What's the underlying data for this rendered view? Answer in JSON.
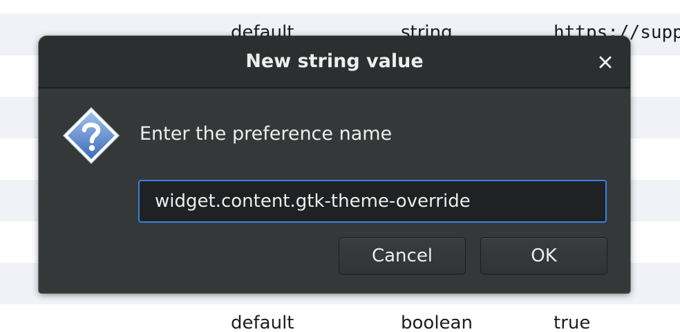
{
  "background": {
    "rows": [
      {
        "default_col": "default",
        "type_col": "string",
        "value_col": "https://suppo"
      },
      {
        "default_col": "default",
        "type_col": "boolean",
        "value_col": "true"
      }
    ]
  },
  "dialog": {
    "title": "New string value",
    "close_icon": "close-icon",
    "prompt": "Enter the preference name",
    "question_icon": "question-icon",
    "input_value": "widget.content.gtk-theme-override",
    "cancel_label": "Cancel",
    "ok_label": "OK"
  },
  "colors": {
    "dialog_bg": "#353839",
    "titlebar_bg": "#2c2f30",
    "input_focus": "#3584e4",
    "row_alt": "#f0f2f7",
    "icon_blue": "#4f7fc4"
  }
}
